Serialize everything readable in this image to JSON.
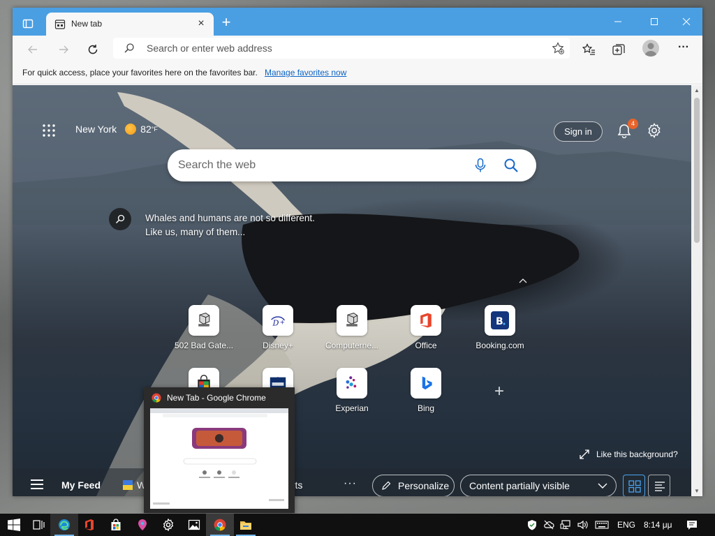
{
  "browser": {
    "tab_title": "New tab",
    "address_placeholder": "Search or enter web address",
    "favbar_message": "For quick access, place your favorites here on the favorites bar.",
    "favbar_link": "Manage favorites now"
  },
  "ntp": {
    "weather_city": "New York",
    "weather_temp": "82",
    "weather_unit": "°F",
    "sign_in": "Sign in",
    "notification_count": "4",
    "search_placeholder": "Search the web",
    "bg_caption_line1": "Whales and humans are not so different.",
    "bg_caption_line2": "Like us, many of them...",
    "tiles": [
      {
        "label": "502 Bad Gate...",
        "icon": "server-icon"
      },
      {
        "label": "Disney+",
        "icon": "disney-plus-icon"
      },
      {
        "label": "Computerne...",
        "icon": "server-icon"
      },
      {
        "label": "Office",
        "icon": "office-icon"
      },
      {
        "label": "Booking.com",
        "icon": "booking-icon"
      },
      {
        "label": "",
        "icon": "shopping-bag-icon"
      },
      {
        "label": "",
        "icon": "lowes-icon"
      },
      {
        "label": "Experian",
        "icon": "experian-icon"
      },
      {
        "label": "Bing",
        "icon": "bing-icon"
      }
    ],
    "like_background": "Like this background?",
    "feed": {
      "my_feed": "My Feed",
      "tab2_visible": "Wa",
      "tab3_visible": "orts",
      "more": "···",
      "personalize": "Personalize",
      "content_visibility": "Content partially visible"
    }
  },
  "preview": {
    "title": "New Tab - Google Chrome"
  },
  "taskbar": {
    "language": "ENG",
    "time": "8:14 μμ"
  },
  "colors": {
    "titlebar": "#4a9fe3",
    "link": "#0b63c5",
    "badge": "#e8632a"
  }
}
